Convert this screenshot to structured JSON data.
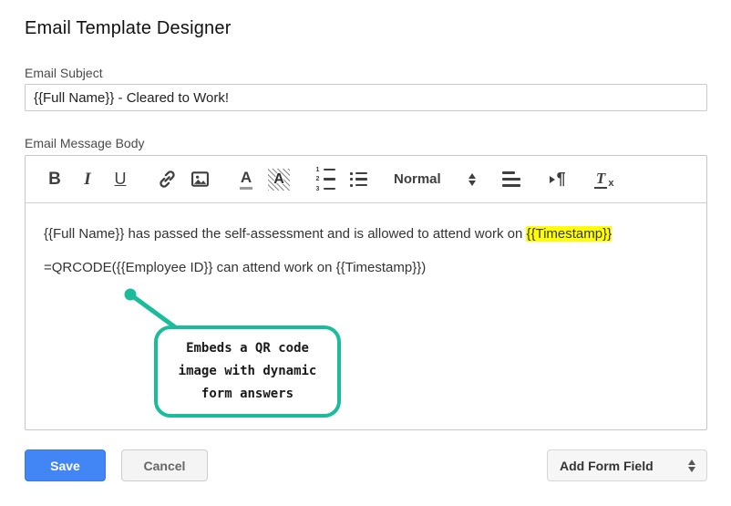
{
  "page_title": "Email Template Designer",
  "subject": {
    "label": "Email Subject",
    "value": "{{Full Name}} - Cleared to Work!"
  },
  "editor": {
    "label": "Email Message Body",
    "toolbar": {
      "bold": "B",
      "italic": "I",
      "underline": "U",
      "text_color_letter": "A",
      "background_color_letter": "A",
      "style_value": "Normal",
      "ordered_list_numbers": [
        "1",
        "2",
        "3"
      ],
      "direction_pilcrow": "¶",
      "clean_letter": "T",
      "clean_sub": "x",
      "icons": [
        "bold",
        "italic",
        "underline",
        "link",
        "image",
        "text-color",
        "background-color",
        "ordered-list",
        "bullet-list",
        "style-select",
        "align",
        "direction-rtl",
        "clear-formatting"
      ]
    },
    "content": {
      "line1_text": "{{Full Name}} has passed the self-assessment and is allowed to attend work on ",
      "line1_highlighted": "{{Timestamp}}",
      "line2_text": "=QRCODE({{Employee ID}} can attend work on {{Timestamp}})"
    }
  },
  "callout": {
    "lines": [
      "Embeds a QR code",
      "image with dynamic",
      "form answers"
    ]
  },
  "actions": {
    "save": "Save",
    "cancel": "Cancel",
    "add_form_field": "Add Form Field"
  },
  "colors": {
    "accent_teal": "#1abc9c",
    "highlight_yellow": "#ffff00",
    "save_blue": "#4285f4"
  }
}
